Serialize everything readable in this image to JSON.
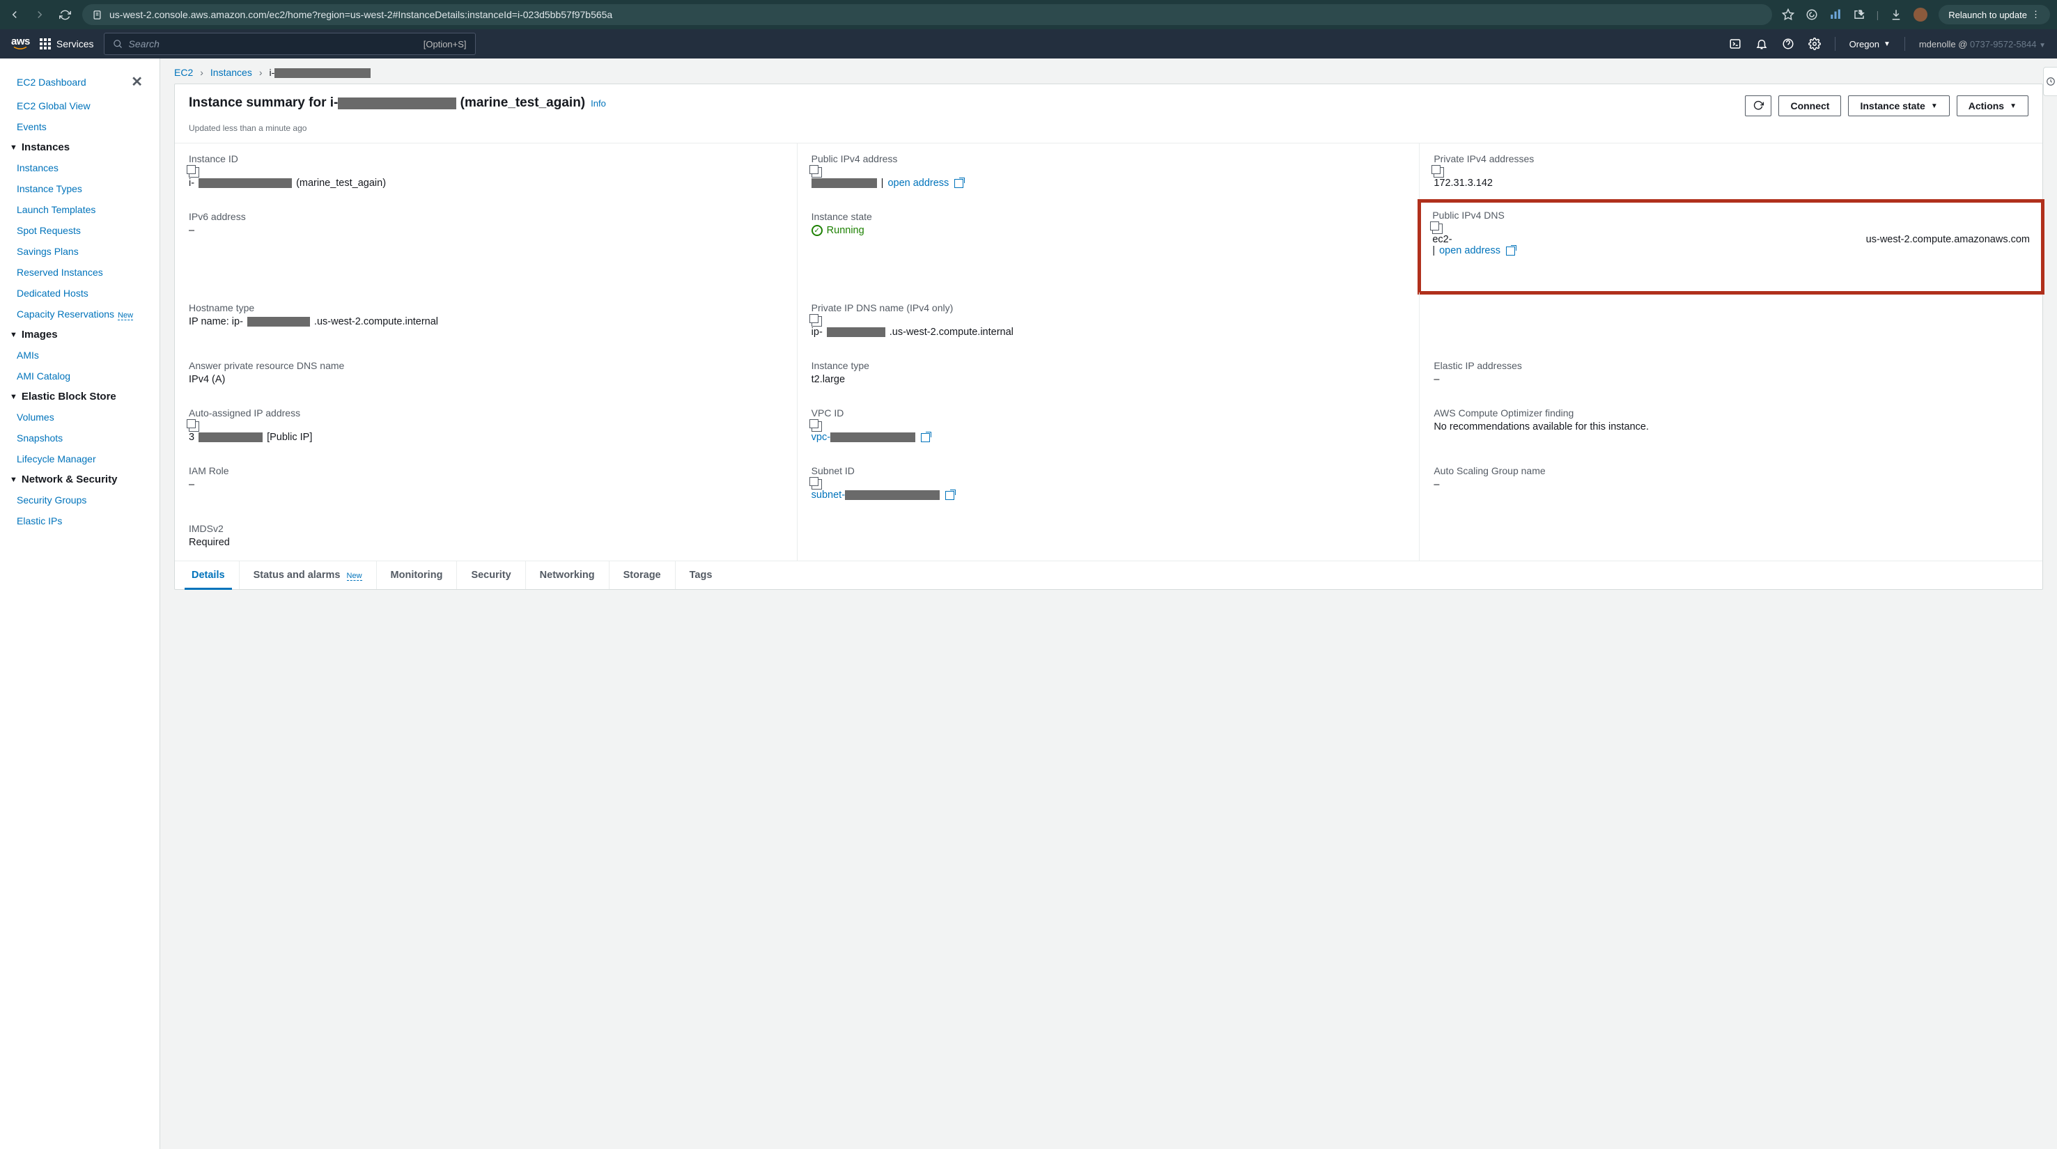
{
  "browser": {
    "url": "us-west-2.console.aws.amazon.com/ec2/home?region=us-west-2#InstanceDetails:instanceId=i-023d5bb57f97b565a",
    "relaunch": "Relaunch to update"
  },
  "nav": {
    "services": "Services",
    "search_placeholder": "Search",
    "search_shortcut": "[Option+S]",
    "region": "Oregon",
    "user": "mdenolle @",
    "account_dim": "0737-9572-5844"
  },
  "sidebar": {
    "top": [
      "EC2 Dashboard",
      "EC2 Global View",
      "Events"
    ],
    "sections": [
      {
        "title": "Instances",
        "items": [
          "Instances",
          "Instance Types",
          "Launch Templates",
          "Spot Requests",
          "Savings Plans",
          "Reserved Instances",
          "Dedicated Hosts",
          "Capacity Reservations"
        ],
        "new_on": "Capacity Reservations"
      },
      {
        "title": "Images",
        "items": [
          "AMIs",
          "AMI Catalog"
        ]
      },
      {
        "title": "Elastic Block Store",
        "items": [
          "Volumes",
          "Snapshots",
          "Lifecycle Manager"
        ]
      },
      {
        "title": "Network & Security",
        "items": [
          "Security Groups",
          "Elastic IPs"
        ]
      }
    ]
  },
  "breadcrumb": {
    "root": "EC2",
    "instances": "Instances",
    "current_prefix": "i-"
  },
  "summary": {
    "title_prefix": "Instance summary for i-",
    "title_suffix": " (marine_test_again)",
    "info": "Info",
    "updated": "Updated less than a minute ago",
    "actions": {
      "connect": "Connect",
      "state": "Instance state",
      "actions": "Actions"
    }
  },
  "details": {
    "instance_id": {
      "label": "Instance ID",
      "prefix": "i-",
      "suffix": " (marine_test_again)"
    },
    "public_ipv4": {
      "label": "Public IPv4 address",
      "open": "open address"
    },
    "private_ipv4": {
      "label": "Private IPv4 addresses",
      "value": "172.31.3.142"
    },
    "ipv6": {
      "label": "IPv6 address",
      "value": "–"
    },
    "instance_state": {
      "label": "Instance state",
      "value": "Running"
    },
    "public_dns": {
      "label": "Public IPv4 DNS",
      "prefix": "ec2-",
      "suffix": "us-west-2.compute.amazonaws.com",
      "open": "open address"
    },
    "hostname_type": {
      "label": "Hostname type",
      "prefix": "IP name: ip-",
      "suffix": ".us-west-2.compute.internal"
    },
    "priv_dns": {
      "label": "Private IP DNS name (IPv4 only)",
      "prefix": "ip-",
      "suffix": ".us-west-2.compute.internal"
    },
    "answer_dns": {
      "label": "Answer private resource DNS name",
      "value": "IPv4 (A)"
    },
    "instance_type": {
      "label": "Instance type",
      "value": "t2.large"
    },
    "elastic_ip": {
      "label": "Elastic IP addresses",
      "value": "–"
    },
    "auto_ip": {
      "label": "Auto-assigned IP address",
      "prefix": "3",
      "suffix": "[Public IP]"
    },
    "vpc": {
      "label": "VPC ID",
      "prefix": "vpc-"
    },
    "optimizer": {
      "label": "AWS Compute Optimizer finding",
      "value": "No recommendations available for this instance."
    },
    "iam": {
      "label": "IAM Role",
      "value": "–"
    },
    "subnet": {
      "label": "Subnet ID",
      "prefix": "subnet-"
    },
    "asg": {
      "label": "Auto Scaling Group name",
      "value": "–"
    },
    "imds": {
      "label": "IMDSv2",
      "value": "Required"
    }
  },
  "tabs": {
    "details": "Details",
    "status": "Status and alarms",
    "status_new": "New",
    "monitoring": "Monitoring",
    "security": "Security",
    "networking": "Networking",
    "storage": "Storage",
    "tags": "Tags"
  }
}
